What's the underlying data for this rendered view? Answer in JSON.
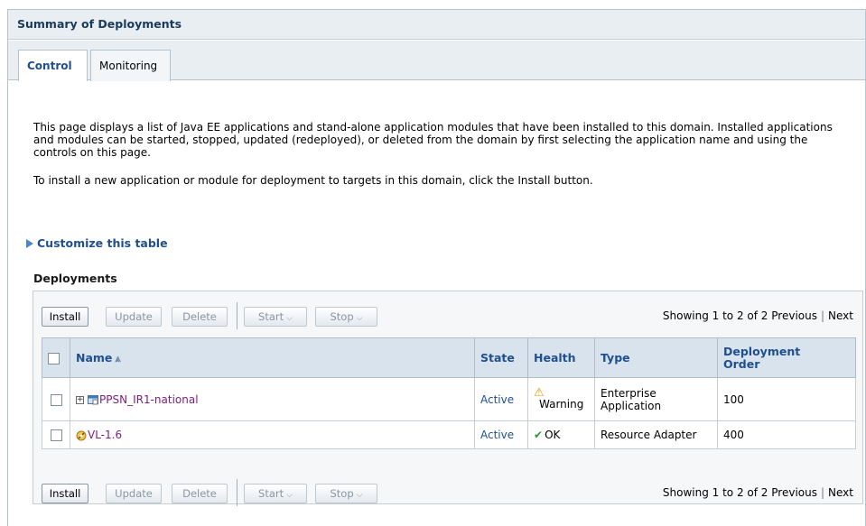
{
  "header": {
    "title": "Summary of Deployments"
  },
  "tabs": [
    {
      "label": "Control"
    },
    {
      "label": "Monitoring"
    }
  ],
  "description": {
    "para1": "This page displays a list of Java EE applications and stand-alone application modules that have been installed to this domain. Installed applications and modules can be started, stopped, updated (redeployed), or deleted from the domain by first selecting the application name and using the controls on this page.",
    "para2": "To install a new application or module for deployment to targets in this domain, click the Install button."
  },
  "customize_link": "Customize this table",
  "deployments_title": "Deployments",
  "toolbar": {
    "install": "Install",
    "update": "Update",
    "delete": "Delete",
    "start": "Start",
    "stop": "Stop"
  },
  "paging": {
    "showing": "Showing 1 to 2 of 2",
    "previous": "Previous",
    "next": "Next"
  },
  "table": {
    "columns": {
      "name": "Name",
      "state": "State",
      "health": "Health",
      "type": "Type",
      "order": "Deployment Order"
    },
    "rows": [
      {
        "name": "PPSN_IR1-national",
        "state": "Active",
        "health": "Warning",
        "type": "Enterprise Application",
        "order": "100"
      },
      {
        "name": "VL-1.6",
        "state": "Active",
        "health": "OK",
        "type": "Resource Adapter",
        "order": "400"
      }
    ]
  },
  "icons": {
    "warning": "warning-icon",
    "ok": "checkmark-icon",
    "app": "enterprise-app-icon",
    "adapter": "resource-adapter-icon"
  },
  "colors": {
    "header_bg": "#e9eef3",
    "link": "#1f4f8e",
    "visited_link": "#7a1f7a",
    "table_header_bg": "#d8e3ee"
  }
}
